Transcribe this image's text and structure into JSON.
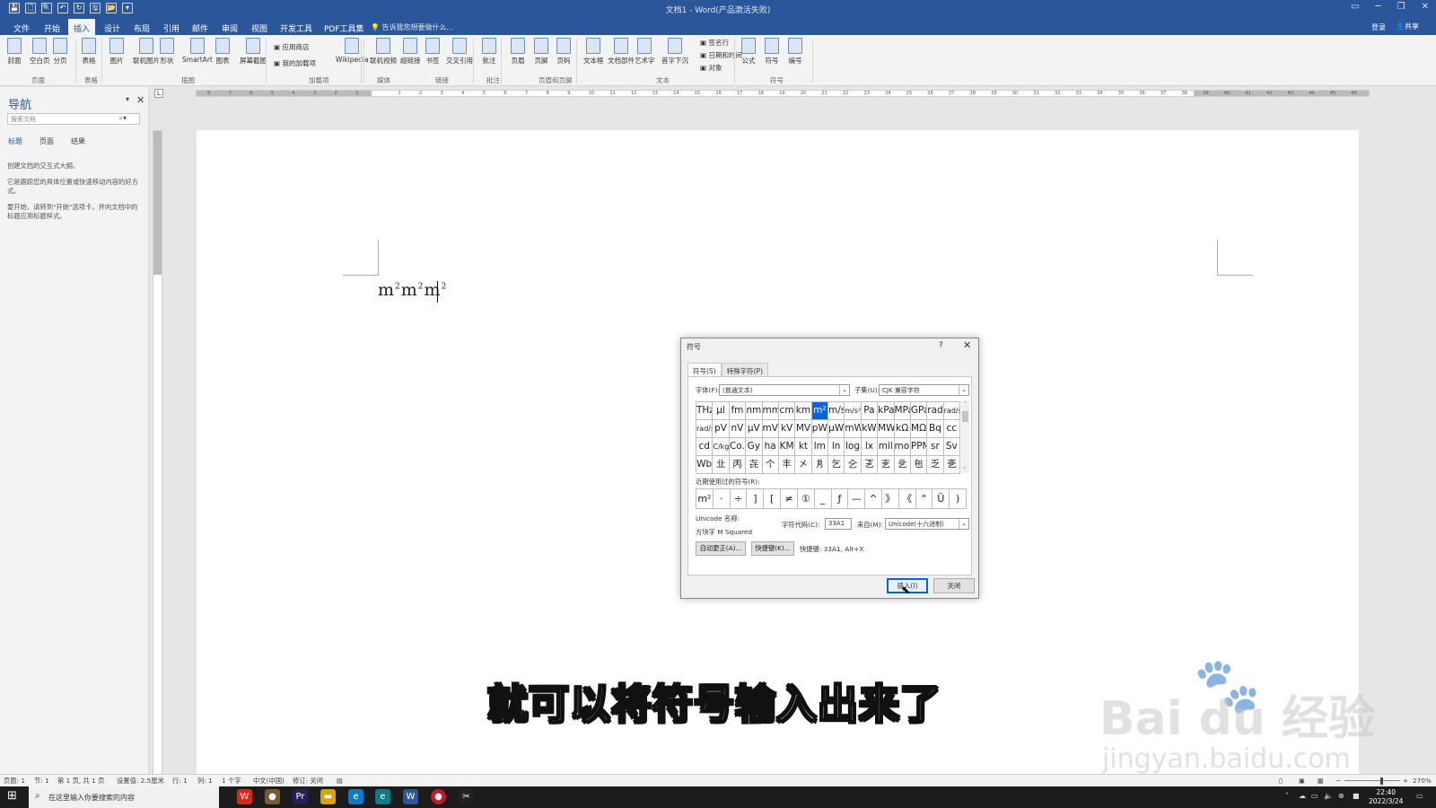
{
  "window": {
    "title": "文档1 - Word(产品激活失败)",
    "quick_access": [
      "💾",
      "🗋",
      "🔍",
      "↶",
      "↻",
      "🖫",
      "📂",
      "▾"
    ]
  },
  "tabs": [
    {
      "label": "文件"
    },
    {
      "label": "开始"
    },
    {
      "label": "插入"
    },
    {
      "label": "设计"
    },
    {
      "label": "布局"
    },
    {
      "label": "引用"
    },
    {
      "label": "邮件"
    },
    {
      "label": "审阅"
    },
    {
      "label": "视图"
    },
    {
      "label": "开发工具"
    },
    {
      "label": "PDF工具集"
    }
  ],
  "tell_me": "告诉我您想要做什么...",
  "account": {
    "login": "登录",
    "share": "共享"
  },
  "ribbon": {
    "buttons": [
      "封面",
      "空白页",
      "分页",
      "表格",
      "图片",
      "联机图片",
      "形状",
      "SmartArt",
      "图表",
      "屏幕截图",
      "Wikipedia",
      "联机视频",
      "超链接",
      "书签",
      "交叉引用",
      "批注",
      "页眉",
      "页脚",
      "页码",
      "文本框",
      "文档部件",
      "艺术字",
      "首字下沉",
      "公式",
      "符号",
      "编号"
    ],
    "small": [
      "应用商店",
      "我的加载项",
      "签名行",
      "日期和时间",
      "对象"
    ],
    "groups": [
      "页面",
      "表格",
      "插图",
      "加载项",
      "媒体",
      "链接",
      "批注",
      "页眉和页脚",
      "文本",
      "符号"
    ]
  },
  "nav_pane": {
    "title": "导航",
    "search_placeholder": "搜索文档",
    "tabs": [
      "标题",
      "页面",
      "结果"
    ],
    "text1": "创建文档的交互式大纲。",
    "text2": "它是跟踪您的具体位置或快速移动内容的好方式。",
    "text3": "要开始，请转到\"开始\"选项卡，并向文档中的标题应用标题样式。"
  },
  "document": {
    "text_base": "m",
    "text_sup": "2",
    "repeat": 3
  },
  "ruler_numbers": [
    "8",
    "7",
    "6",
    "5",
    "4",
    "3",
    "2",
    "1",
    "",
    "1",
    "2",
    "3",
    "4",
    "5",
    "6",
    "7",
    "8",
    "9",
    "10",
    "11",
    "12",
    "13",
    "14",
    "15",
    "16",
    "17",
    "18",
    "19",
    "20",
    "21",
    "22",
    "23",
    "24",
    "25",
    "26",
    "27",
    "28",
    "29",
    "30",
    "31",
    "32",
    "33",
    "34",
    "35",
    "36",
    "37",
    "38",
    "39",
    "40",
    "41",
    "42",
    "43",
    "44",
    "45",
    "46"
  ],
  "dialog": {
    "title": "符号",
    "help": "?",
    "tab_symbols": "符号(S)",
    "tab_special": "特殊字符(P)",
    "font_label": "字体(F):",
    "font_value": "(普通文本)",
    "subset_label": "子集(U):",
    "subset_value": "CJK 兼容字符",
    "grid": [
      "THz",
      "μl",
      "fm",
      "nm",
      "mm",
      "cm",
      "km",
      "m²",
      "m/s",
      "m/s²",
      "Pa",
      "kPa",
      "MPa",
      "GPa",
      "rad",
      "rad/s",
      "rad/s²",
      "pV",
      "nV",
      "μV",
      "mV",
      "kV",
      "MV",
      "pW",
      "μW",
      "mW",
      "kW",
      "MW",
      "kΩ",
      "MΩ",
      "Bq",
      "cc",
      "cd",
      "C/kg",
      "Co.",
      "Gy",
      "ha",
      "KM",
      "kt",
      "lm",
      "ln",
      "log",
      "lx",
      "mil",
      "mol",
      "PPM",
      "sr",
      "Sv",
      "Wb",
      "㐀",
      "丙",
      "㐂",
      "个",
      "丰",
      "㐅",
      "㐆",
      "乞",
      "㐈",
      "乤",
      "㐊",
      "乧",
      "㐌",
      "乏",
      "㐎"
    ],
    "selected_index": 7,
    "recent_label": "近期使用过的符号(R):",
    "recent": [
      "m²",
      "·",
      "÷",
      "]",
      "[",
      "≠",
      "①",
      "_",
      "ƒ",
      "—",
      "^",
      "》",
      "《",
      "\"",
      "Ü",
      ")"
    ],
    "unicode_name_label": "Unicode 名称:",
    "unicode_name": "方块字 M Squared",
    "char_code_label": "字符代码(C):",
    "char_code": "33A1",
    "from_label": "来自(M):",
    "from_value": "Unicode(十六进制)",
    "autocorrect": "自动更正(A)...",
    "shortcut_key": "快捷键(K)...",
    "shortcut_text": "快捷键: 33A1, Alt+X",
    "insert": "插入(I)",
    "close": "关闭"
  },
  "caption": "就可以将符号输入出来了",
  "watermark": {
    "brand": "Bai du 经验",
    "url": "jingyan.baidu.com"
  },
  "status": {
    "page": "页面: 1",
    "section": "节: 1",
    "pages": "第 1 页, 共 1 页",
    "position": "设置值: 2.5厘米",
    "line": "行: 1",
    "column": "列: 1",
    "words": "1 个字",
    "lang": "中文(中国)",
    "track": "修订: 关闭",
    "zoom": "270%"
  },
  "taskbar": {
    "search": "在这里输入你要搜索的内容",
    "time": "22:40",
    "date": "2022/3/24"
  }
}
